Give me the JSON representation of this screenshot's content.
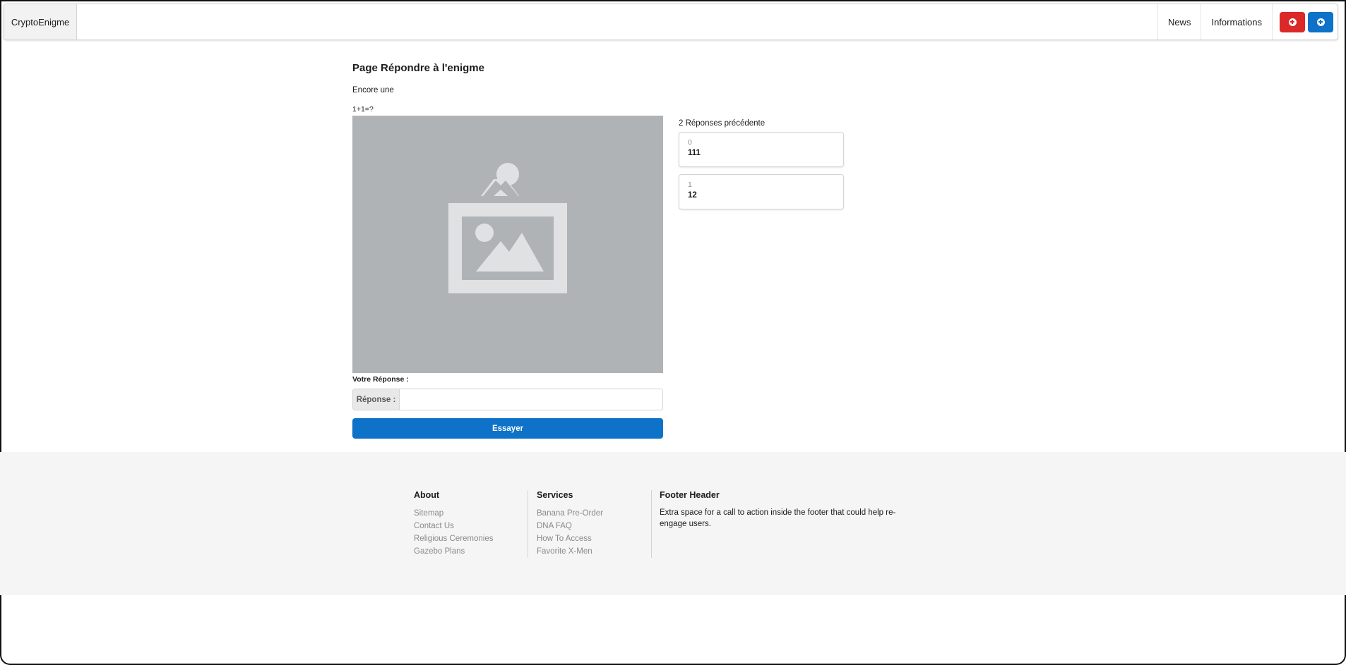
{
  "header": {
    "brand": "CryptoEnigme",
    "nav": [
      {
        "label": "News"
      },
      {
        "label": "Informations"
      }
    ],
    "buttons": [
      {
        "icon": "plus-circle-icon",
        "color": "#db2828"
      },
      {
        "icon": "plus-circle-icon",
        "color": "#0d72c8"
      }
    ]
  },
  "main": {
    "title": "Page Répondre à l'enigme",
    "subtitle": "Encore une",
    "question": "1+1=?",
    "image": {
      "icon": "image-placeholder-icon"
    },
    "answer_label": "Votre Réponse :",
    "input": {
      "label": "Réponse :",
      "value": "",
      "placeholder": ""
    },
    "submit_label": "Essayer"
  },
  "previous": {
    "title": "2 Réponses précédente",
    "items": [
      {
        "index": "0",
        "value": "111"
      },
      {
        "index": "1",
        "value": "12"
      }
    ]
  },
  "footer": {
    "about": {
      "heading": "About",
      "links": [
        "Sitemap",
        "Contact Us",
        "Religious Ceremonies",
        "Gazebo Plans"
      ]
    },
    "services": {
      "heading": "Services",
      "links": [
        "Banana Pre-Order",
        "DNA FAQ",
        "How To Access",
        "Favorite X-Men"
      ]
    },
    "extra": {
      "heading": "Footer Header",
      "text": "Extra space for a call to action inside the footer that could help re-engage users."
    }
  },
  "colors": {
    "accent": "#0d72c8",
    "danger": "#db2828",
    "footer_bg": "#f5f5f5"
  }
}
